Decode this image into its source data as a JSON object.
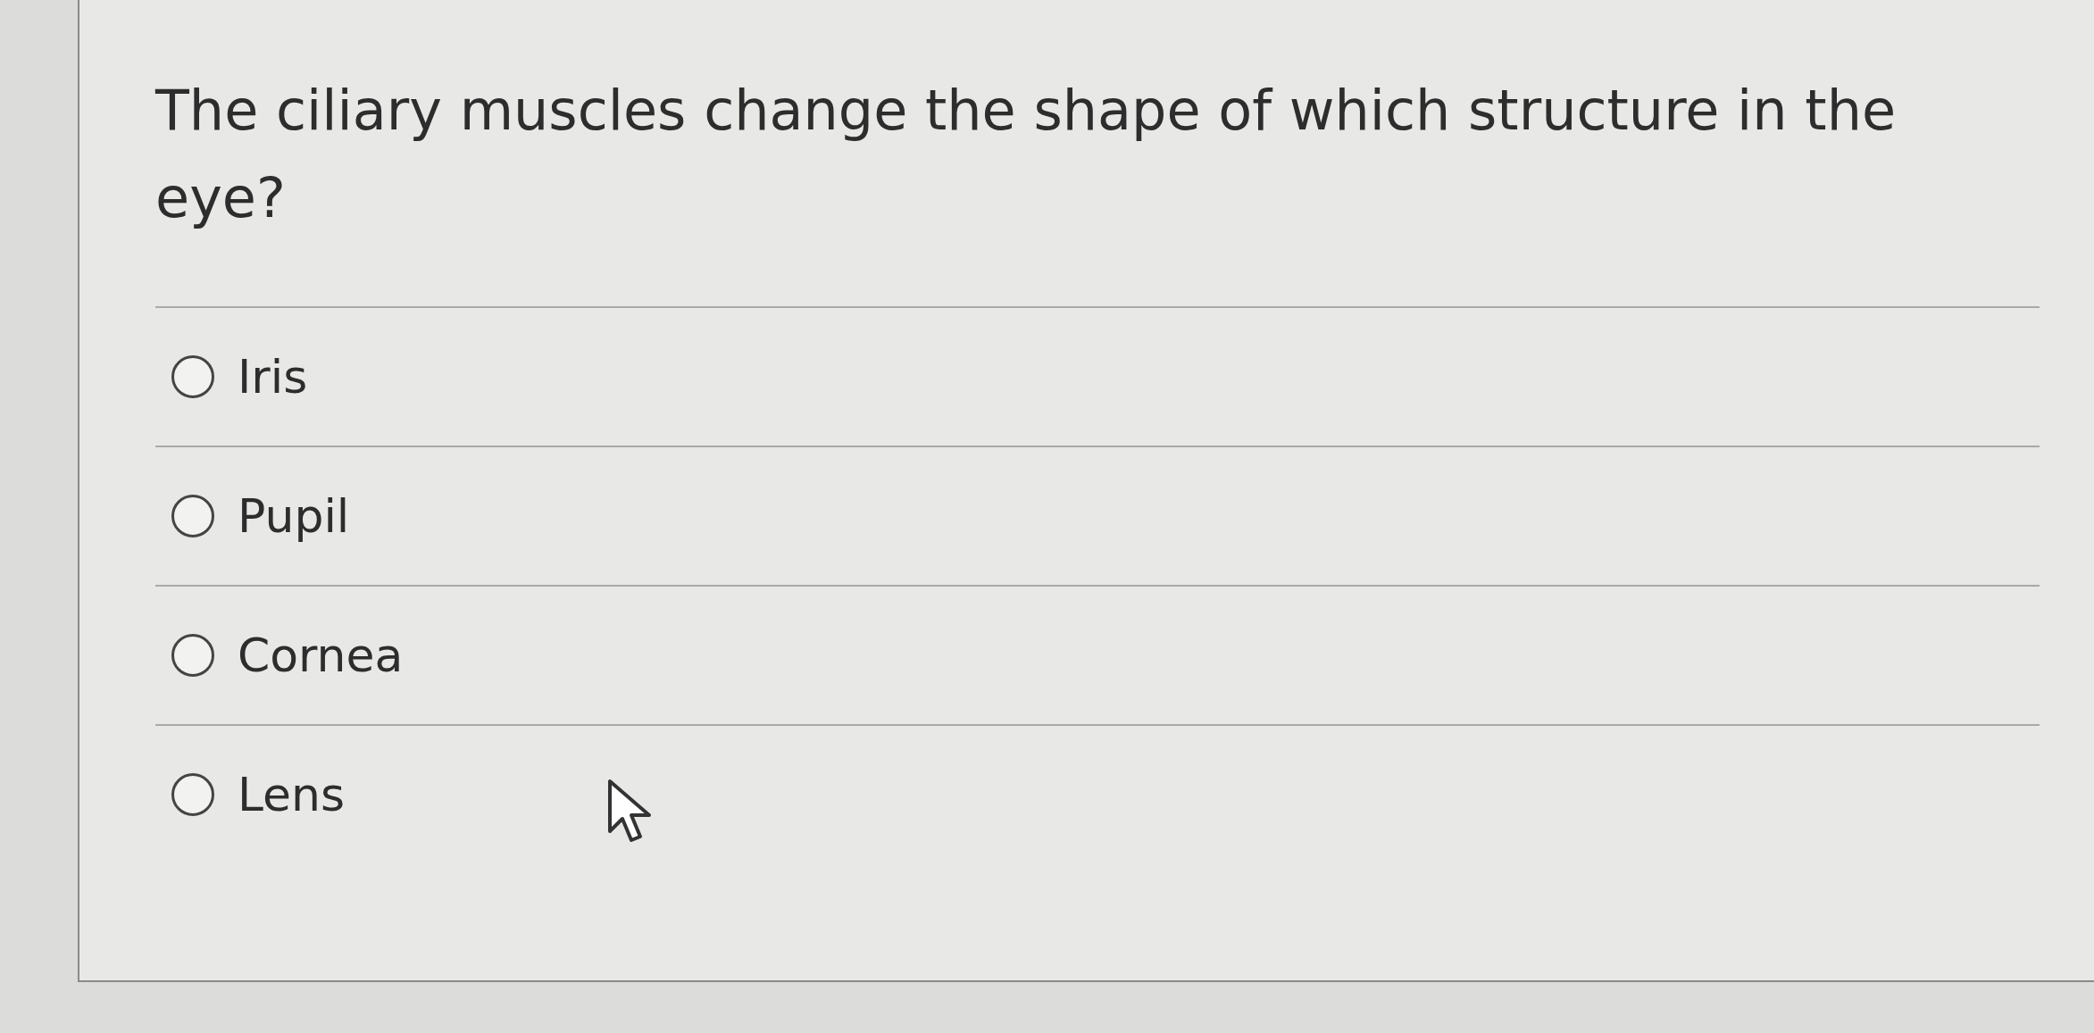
{
  "question": "The ciliary muscles change the shape of which structure in the eye?",
  "options": [
    {
      "label": "Iris",
      "selected": false
    },
    {
      "label": "Pupil",
      "selected": false
    },
    {
      "label": "Cornea",
      "selected": false
    },
    {
      "label": "Lens",
      "selected": false
    }
  ]
}
